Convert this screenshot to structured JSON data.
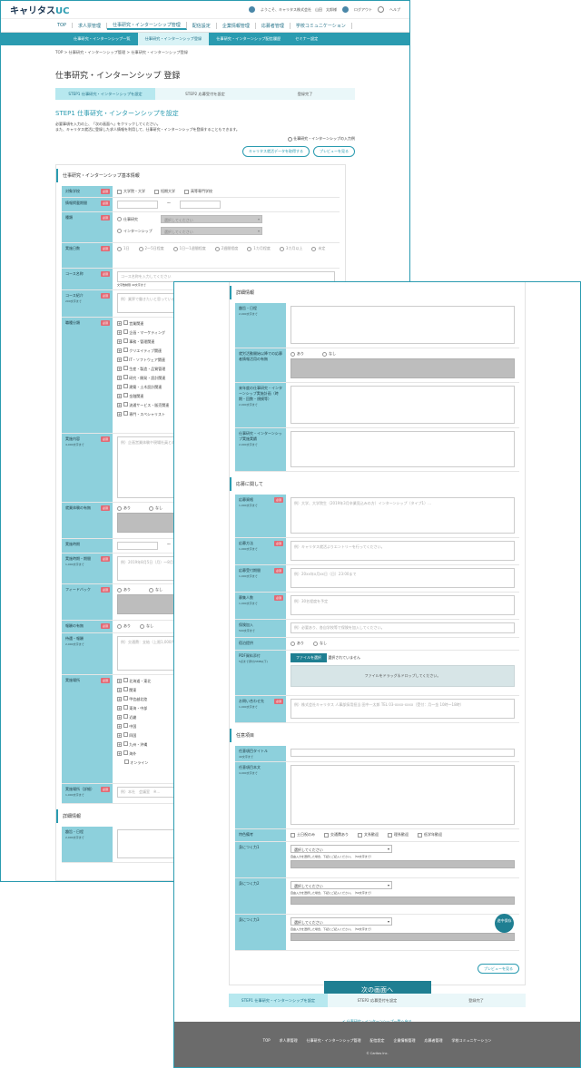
{
  "header": {
    "logo_main": "キャリタス",
    "logo_suffix": "UC",
    "welcome": "ようこそ、キャリタス株式会社　山田　太郎様",
    "logout": "ログアウト",
    "help": "ヘルプ"
  },
  "nav_main": [
    "TOP",
    "求人票管理",
    "仕事研究・インターンシップ管理",
    "配信設定",
    "企業情報管理",
    "応募者管理",
    "学校コミュニケーション"
  ],
  "nav_sub": [
    "仕事研究・インターンシップ一覧",
    "仕事研究・インターンシップ登録",
    "仕事研究・インターンシップ配信履歴",
    "セミナー設定"
  ],
  "breadcrumb": "TOP > 仕事研究・インターンシップ管理 > 仕事研究・インターンシップ登録",
  "page_title": "仕事研究・インターンシップ 登録",
  "steps": [
    "STEP1 仕事研究・インターンシップを設定",
    "STEP2 応募受付を設定",
    "登録完了"
  ],
  "step_title": "STEP1 仕事研究・インターンシップを設定",
  "desc1": "必要事項を入力の上、「次の画面へ」をクリックしてください。",
  "desc2": "また、キャリタス就活に登録した求人情報を利用して、仕事研究・インターンシップを登録することもできます。",
  "guide_link": "仕事研究・インターンシップの入力例",
  "copy_btn": "キャリタス就活データを取得する",
  "preview_btn": "プレビューを見る",
  "basic": {
    "title": "仕事研究・インターンシップ基本情報",
    "target_label": "対象学校",
    "req": "必須",
    "target_opts": [
      "大学院・大学",
      "短期大学",
      "高等専門学校"
    ],
    "period_label": "情報掲載期間",
    "type_label": "種類",
    "type_opts": [
      "仕事研究",
      "インターンシップ"
    ],
    "select_ph": "選択してください",
    "days_label": "実施日数",
    "days_opts": [
      "1日",
      "2〜5日程度",
      "1日〜1週間程度",
      "2週間程度",
      "1カ月程度",
      "3カ月以上",
      "未定"
    ],
    "course_label": "コース名称",
    "course_ph": "コース名称を入力してください",
    "course_note": "文字数制限 40文字まで",
    "intro_label": "コース紹介",
    "intro_note": "200文字まで",
    "intro_ph": "例）業界で働きたいと思っている学生の皆さんに、より理解を深めていただくための仕事研究…",
    "job_label": "職種分類",
    "jobs": [
      "営業関連",
      "企画・マーケティング",
      "事務・管理関連",
      "クリエイティブ関連",
      "IT・ソフトウェア関連",
      "生産・製造・品質管理",
      "研究・開発・設計関連",
      "建築・土木設計関連",
      "金融関連",
      "流通サービス・販売関連",
      "専門・スペシャリスト"
    ],
    "content_label": "実施内容",
    "content_note": "4,000文字まで",
    "content_ph": "例）企画営業体験や現場社員との座談会を通じ、業界の理解を深めていただきます。",
    "paid_label": "就業体験の有無",
    "yes": "あり",
    "no": "なし",
    "date_label": "実施時期",
    "time_label": "実施時期・期間",
    "time_note": "1,000文字まで",
    "time_ph": "例）2019年8月5日（月）〜8月9日（金）インターンシップ（タイプ1）…",
    "feedback_label": "フィードバック",
    "reward_label": "報酬の有無",
    "pay_label": "待遇・報酬",
    "pay_note": "2,000文字まで",
    "pay_ph": "例）交通費：支給（上限1,000円）",
    "place_label": "実施場所",
    "places": [
      "北海道・東北",
      "関東",
      "甲信越北陸",
      "東海・中部",
      "近畿",
      "中国",
      "四国",
      "九州・沖縄",
      "海外",
      "オンライン"
    ],
    "place_detail_label": "実施場所（詳細）",
    "place_detail_note": "1,000文字まで",
    "place_detail_ph": "例）本社　会議室　※…"
  },
  "detail": {
    "title": "詳細情報",
    "schedule_label": "趣旨・日程",
    "schedule_note": "2,000文字まで",
    "paid_use_label": "就労活動開始以降での応募者情報活用の有無",
    "future_label": "来年度の仕事研究・インターンシップ実施計画（時期・回数・規模等）",
    "future_note": "2,000文字まで",
    "record_label": "仕事研究・インターンシップ実施実績",
    "record_note": "2,000文字まで"
  },
  "apply": {
    "title": "応募に関して",
    "req_label": "応募資格",
    "req_note": "1,000文字まで",
    "req_ph": "例）大学、大学院生（2019年3月卒業見込みの方）インターンシップ（タイプ1）…",
    "method_label": "応募方法",
    "method_note": "1,000文字まで",
    "method_ph": "例）キャリタス就活よりエントリーを行ってください。",
    "deadline_label": "応募受付期間",
    "deadline_note": "1,000文字まで",
    "deadline_ph": "例）20xx年x月xx日（日）23:00まで",
    "count_label": "募集人数",
    "count_note": "1,000文字まで",
    "count_ph": "例）30名程度を予定",
    "insurance_label": "保険加入",
    "insurance_note": "500文字まで",
    "insurance_ph": "例）必要あり、各自学校等で保険を加入してください。",
    "lodging_label": "宿泊提供",
    "pdf_label": "PDF資料添付",
    "pdf_note": "5点まで添付(5MB以下)",
    "file_btn": "ファイルを選択",
    "file_none": "選択されていません",
    "drop_text": "ファイルをドラッグ＆ドロップしてください。",
    "contact_label": "お問い合わせ先",
    "contact_note": "1,000文字まで",
    "contact_ph": "例）株式会社キャリタス 人事部採用担当 田中一太郎 TEL 03-xxxx-xxxx（受付：月〜金 10時〜18時）"
  },
  "optional": {
    "title": "任意項目",
    "free_title_label": "任意項目タイトル",
    "free_title_note": "40文字まで",
    "free_body_label": "任意項目本文",
    "free_body_note": "4,000文字まで",
    "feature_label": "特色備考",
    "features": [
      "土日祝のみ",
      "交通費あり",
      "文系歓迎",
      "理系歓迎",
      "低学年歓迎"
    ],
    "skill1_label": "身につく力1",
    "skill2_label": "身につく力2",
    "skill3_label": "身につく力3",
    "skill_note": "自由入力を選択した場合、下記にご記入ください。（50文字まで）"
  },
  "save_badge": "途中保存",
  "next_btn": "次の画面へ",
  "back_link": "< 仕事研究・インターンシップ一覧へ戻る",
  "footer_links": [
    "TOP",
    "求人票管理",
    "仕事研究・インターンシップ管理",
    "配信設定",
    "企業情報管理",
    "応募者管理",
    "学校コミュニケーション"
  ],
  "copyright": "© Caritas Inc."
}
